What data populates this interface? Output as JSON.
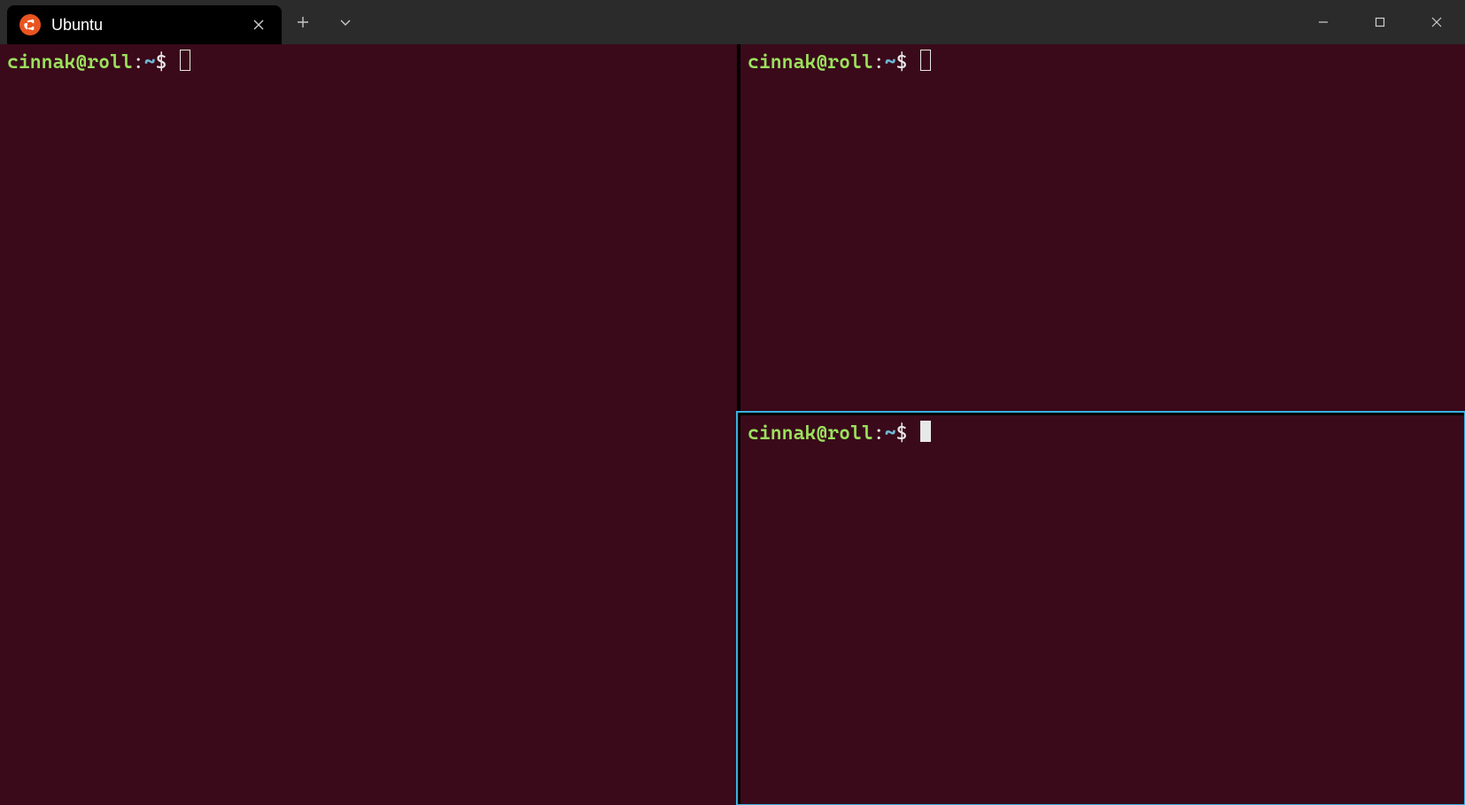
{
  "tabs": [
    {
      "title": "Ubuntu"
    }
  ],
  "panes": {
    "left": {
      "user_host": "cinnak@roll",
      "separator": ":",
      "path": "~",
      "symbol": "$"
    },
    "top_right": {
      "user_host": "cinnak@roll",
      "separator": ":",
      "path": "~",
      "symbol": "$"
    },
    "bottom_right": {
      "user_host": "cinnak@roll",
      "separator": ":",
      "path": "~",
      "symbol": "$"
    }
  },
  "active_pane": "bottom_right"
}
